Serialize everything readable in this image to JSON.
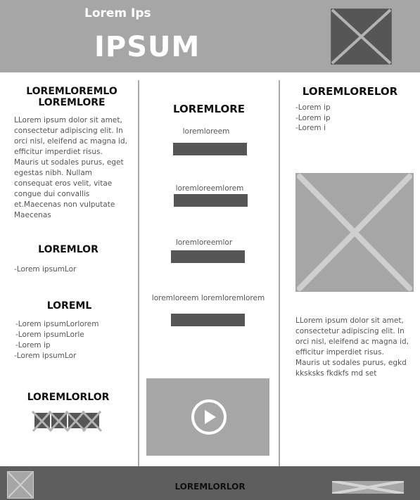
{
  "header": {
    "small_title": "Lorem Ips",
    "big_title": "IPSUM"
  },
  "left_col": {
    "title1_line1": "LOREMLOREMLO",
    "title1_line2": "LOREMLORE",
    "paragraph": [
      "LLorem ipsum dolor sit amet,",
      "consectetur adipiscing elit. In",
      "orci nisl, eleifend ac magna id,",
      "efficitur imperdiet risus.",
      "Mauris ut sodales purus, eget",
      "egestas nibh. Nullam",
      "consequat eros velit, vitae",
      "congue dui convallis",
      "et.Maecenas non vulputate",
      "Maecenas"
    ],
    "title2": "LOREMLOR",
    "list2": [
      "-Lorem ipsumLor"
    ],
    "title3": "LOREML",
    "list3": [
      "-Lorem ipsumLorlorem",
      "-Lorem ipsumLorle",
      "-Lorem ip",
      "-Lorem ipsumLor"
    ],
    "title4": "LOREMLORLOR"
  },
  "mid_col": {
    "title": "LOREMLORE",
    "items": [
      {
        "label": "loremloreem"
      },
      {
        "label": "loremloreemlorem"
      },
      {
        "label": "loremloreemlor"
      },
      {
        "label": "loremloreem loremloremlorem"
      }
    ]
  },
  "right_col": {
    "title": "LOREMLORELOR",
    "list": [
      "-Lorem ip",
      "-Lorem ip",
      "-Lorem i"
    ],
    "paragraph": [
      "LLorem ipsum dolor sit amet,",
      "consectetur adipiscing elit. In",
      "orci nisl, eleifend ac magna id,",
      "efficitur imperdiet risus.",
      "Mauris ut sodales purus, egkd",
      "kksksks fkdkfs md set"
    ]
  },
  "footer": {
    "title": "LOREMLORLOR"
  },
  "colors": {
    "header_bg": "#a6a6a6",
    "footer_bg": "#5e5e5e",
    "bar": "#565656",
    "placeholder_dark": "#565656",
    "placeholder_light": "#a6a6a6"
  },
  "icons": [
    "image-placeholder-icon",
    "play-icon",
    "menu-icon"
  ]
}
